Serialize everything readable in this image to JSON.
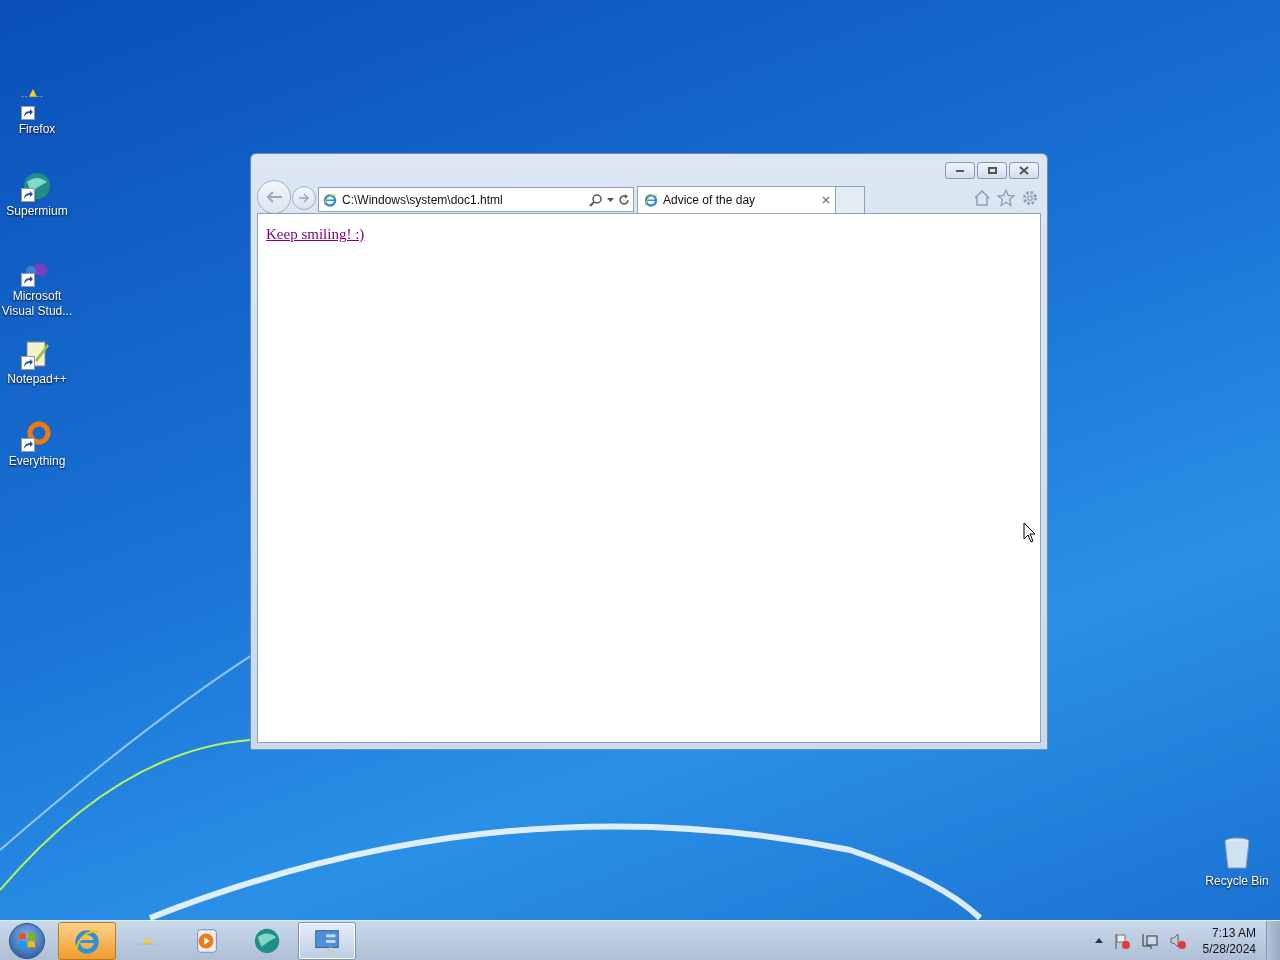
{
  "desktop_icons": [
    {
      "label": "Firefox",
      "kind": "firefox"
    },
    {
      "label": "Supermium",
      "kind": "supermium"
    },
    {
      "label": "Microsoft Visual Stud...",
      "kind": "vs"
    },
    {
      "label": "Notepad++",
      "kind": "notepad"
    },
    {
      "label": "Everything",
      "kind": "everything"
    }
  ],
  "recycle_bin": {
    "label": "Recycle Bin"
  },
  "browser": {
    "address": "C:\\Windows\\system\\doc1.html",
    "tab": {
      "title": "Advice of the day",
      "selected": true
    },
    "link": "Keep smiling! :)"
  },
  "taskbar": {
    "items": [
      {
        "kind": "ie",
        "selected": true,
        "open": false
      },
      {
        "kind": "firefox",
        "selected": false,
        "open": false
      },
      {
        "kind": "media",
        "selected": false,
        "open": false
      },
      {
        "kind": "supermium",
        "selected": false,
        "open": false
      },
      {
        "kind": "control",
        "selected": false,
        "open": true
      }
    ],
    "clock": {
      "time": "7:13 AM",
      "date": "5/28/2024"
    }
  }
}
